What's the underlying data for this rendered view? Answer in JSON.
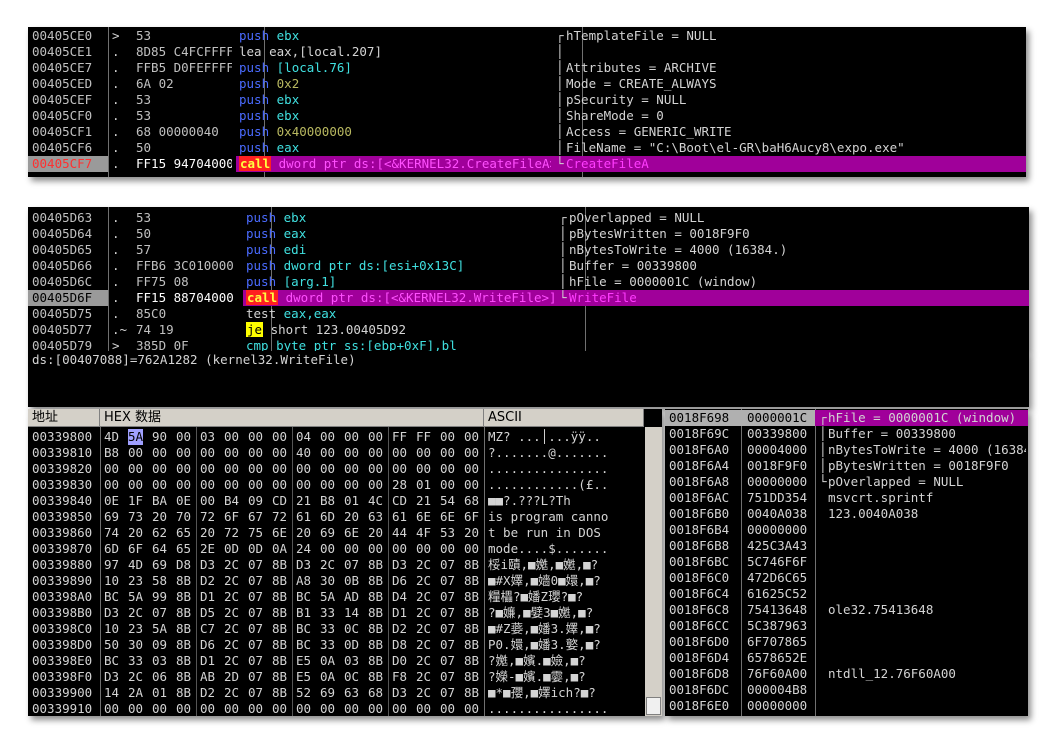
{
  "disasm_top": {
    "rows": [
      {
        "addr": "00405CE0",
        "mark": ">",
        "hex": "53",
        "instr": [
          [
            "push ",
            "blue"
          ],
          [
            "ebx",
            "cyan"
          ]
        ],
        "comment": "hTemplateFile = NULL",
        "bracket": "┌"
      },
      {
        "addr": "00405CE1",
        "mark": ".",
        "hex": "8D85 C4FCFFFF",
        "instr": [
          [
            "lea eax,[local.207]",
            "white"
          ]
        ],
        "comment": "",
        "bracket": "│"
      },
      {
        "addr": "00405CE7",
        "mark": ".",
        "hex": "FFB5 D0FEFFFF",
        "instr": [
          [
            "push ",
            "blue"
          ],
          [
            "[local.76]",
            "cyan"
          ]
        ],
        "comment": "Attributes = ARCHIVE",
        "bracket": "│"
      },
      {
        "addr": "00405CED",
        "mark": ".",
        "hex": "6A 02",
        "instr": [
          [
            "push ",
            "blue"
          ],
          [
            "0x2",
            "olive"
          ]
        ],
        "comment": "Mode = CREATE_ALWAYS",
        "bracket": "│"
      },
      {
        "addr": "00405CEF",
        "mark": ".",
        "hex": "53",
        "instr": [
          [
            "push ",
            "blue"
          ],
          [
            "ebx",
            "cyan"
          ]
        ],
        "comment": "pSecurity = NULL",
        "bracket": "│"
      },
      {
        "addr": "00405CF0",
        "mark": ".",
        "hex": "53",
        "instr": [
          [
            "push ",
            "blue"
          ],
          [
            "ebx",
            "cyan"
          ]
        ],
        "comment": "ShareMode = 0",
        "bracket": "│"
      },
      {
        "addr": "00405CF1",
        "mark": ".",
        "hex": "68 00000040",
        "instr": [
          [
            "push ",
            "blue"
          ],
          [
            "0x40000000",
            "olive"
          ]
        ],
        "comment": "Access = GENERIC_WRITE",
        "bracket": "│"
      },
      {
        "addr": "00405CF6",
        "mark": ".",
        "hex": "50",
        "instr": [
          [
            "push ",
            "blue"
          ],
          [
            "eax",
            "cyan"
          ]
        ],
        "comment": "FileName = \"C:\\Boot\\el-GR\\baH6Aucy8\\expo.exe\"",
        "bracket": "│"
      },
      {
        "addr": "00405CF7",
        "mark": ".",
        "hex": "FF15 94704000",
        "instr": [
          [
            "call",
            "callbox"
          ],
          [
            " dword ptr ds:[<&KERNEL32.CreateFileA>]",
            "mag"
          ]
        ],
        "comment": "CreateFileA",
        "bracket": "└",
        "selected": true
      }
    ]
  },
  "disasm_mid": {
    "rows": [
      {
        "addr": "00405D63",
        "mark": ".",
        "hex": "53",
        "instr": [
          [
            "push ",
            "blue"
          ],
          [
            "ebx",
            "cyan"
          ]
        ],
        "comment": "pOverlapped = NULL",
        "bracket": "┌"
      },
      {
        "addr": "00405D64",
        "mark": ".",
        "hex": "50",
        "instr": [
          [
            "push ",
            "blue"
          ],
          [
            "eax",
            "cyan"
          ]
        ],
        "comment": "pBytesWritten = 0018F9F0",
        "bracket": "│"
      },
      {
        "addr": "00405D65",
        "mark": ".",
        "hex": "57",
        "instr": [
          [
            "push ",
            "blue"
          ],
          [
            "edi",
            "cyan"
          ]
        ],
        "comment": "nBytesToWrite = 4000 (16384.)",
        "bracket": "│"
      },
      {
        "addr": "00405D66",
        "mark": ".",
        "hex": "FFB6 3C010000",
        "instr": [
          [
            "push ",
            "blue"
          ],
          [
            "dword ptr ds:[esi+0x13C]",
            "cyan"
          ]
        ],
        "comment": "Buffer = 00339800",
        "bracket": "│"
      },
      {
        "addr": "00405D6C",
        "mark": ".",
        "hex": "FF75 08",
        "instr": [
          [
            "push ",
            "blue"
          ],
          [
            "[arg.1]",
            "cyan"
          ]
        ],
        "comment": "hFile = 0000001C (window)",
        "bracket": "│"
      },
      {
        "addr": "00405D6F",
        "mark": ".",
        "hex": "FF15 88704000",
        "instr": [
          [
            "call",
            "callbox"
          ],
          [
            " dword ptr ds:[<&KERNEL32.WriteFile>]",
            "mag"
          ]
        ],
        "comment": "WriteFile",
        "bracket": "└",
        "selected": true
      },
      {
        "addr": "00405D75",
        "mark": ".",
        "hex": "85C0",
        "instr": [
          [
            "test ",
            "white"
          ],
          [
            "eax,eax",
            "cyan"
          ]
        ],
        "comment": "",
        "bracket": ""
      },
      {
        "addr": "00405D77",
        "mark": ".~",
        "hex": "74 19",
        "instr": [
          [
            "je",
            "jebox"
          ],
          [
            " short 123.00405D92",
            "white"
          ]
        ],
        "comment": "",
        "bracket": ""
      },
      {
        "addr": "00405D79",
        "mark": ">",
        "hex": "385D 0F",
        "instr": [
          [
            "cmp byte ptr ss:[ebp+0xF],bl",
            "cyan"
          ]
        ],
        "comment": "",
        "bracket": ""
      }
    ],
    "info": "ds:[00407088]=762A1282 (kernel32.WriteFile)"
  },
  "dump": {
    "headers": {
      "addr": "地址",
      "hex": "HEX 数据",
      "ascii": "ASCII"
    },
    "rows": [
      {
        "addr": "00339800",
        "hex": [
          "4D",
          "5A",
          "90",
          "00",
          "03",
          "00",
          "00",
          "00",
          "04",
          "00",
          "00",
          "00",
          "FF",
          "FF",
          "00",
          "00"
        ],
        "ascii": "MZ? ...│...ÿÿ.."
      },
      {
        "addr": "00339810",
        "hex": [
          "B8",
          "00",
          "00",
          "00",
          "00",
          "00",
          "00",
          "00",
          "40",
          "00",
          "00",
          "00",
          "00",
          "00",
          "00",
          "00"
        ],
        "ascii": "?.......@......."
      },
      {
        "addr": "00339820",
        "hex": [
          "00",
          "00",
          "00",
          "00",
          "00",
          "00",
          "00",
          "00",
          "00",
          "00",
          "00",
          "00",
          "00",
          "00",
          "00",
          "00"
        ],
        "ascii": "................"
      },
      {
        "addr": "00339830",
        "hex": [
          "00",
          "00",
          "00",
          "00",
          "00",
          "00",
          "00",
          "00",
          "00",
          "00",
          "00",
          "00",
          "28",
          "01",
          "00",
          "00"
        ],
        "ascii": "............(£.."
      },
      {
        "addr": "00339840",
        "hex": [
          "0E",
          "1F",
          "BA",
          "0E",
          "00",
          "B4",
          "09",
          "CD",
          "21",
          "B8",
          "01",
          "4C",
          "CD",
          "21",
          "54",
          "68"
        ],
        "ascii": "■■?.???L?Th"
      },
      {
        "addr": "00339850",
        "hex": [
          "69",
          "73",
          "20",
          "70",
          "72",
          "6F",
          "67",
          "72",
          "61",
          "6D",
          "20",
          "63",
          "61",
          "6E",
          "6E",
          "6F"
        ],
        "ascii": "is program canno"
      },
      {
        "addr": "00339860",
        "hex": [
          "74",
          "20",
          "62",
          "65",
          "20",
          "72",
          "75",
          "6E",
          "20",
          "69",
          "6E",
          "20",
          "44",
          "4F",
          "53",
          "20"
        ],
        "ascii": "t be run in DOS "
      },
      {
        "addr": "00339870",
        "hex": [
          "6D",
          "6F",
          "64",
          "65",
          "2E",
          "0D",
          "0D",
          "0A",
          "24",
          "00",
          "00",
          "00",
          "00",
          "00",
          "00",
          "00"
        ],
        "ascii": "mode....$......."
      },
      {
        "addr": "00339880",
        "hex": [
          "97",
          "4D",
          "69",
          "D8",
          "D3",
          "2C",
          "07",
          "8B",
          "D3",
          "2C",
          "07",
          "8B",
          "D3",
          "2C",
          "07",
          "8B"
        ],
        "ascii": "桵i賾,■嬔,■嬔,■?"
      },
      {
        "addr": "00339890",
        "hex": [
          "10",
          "23",
          "58",
          "8B",
          "D2",
          "2C",
          "07",
          "8B",
          "A8",
          "30",
          "0B",
          "8B",
          "D6",
          "2C",
          "07",
          "8B"
        ],
        "ascii": "■#X嬕,■嬙0■嬛,■?"
      },
      {
        "addr": "003398A0",
        "hex": [
          "BC",
          "5A",
          "99",
          "8B",
          "D1",
          "2C",
          "07",
          "8B",
          "BC",
          "5A",
          "AD",
          "8B",
          "D4",
          "2C",
          "07",
          "8B"
        ],
        "ascii": "糧櫑?■嬏Z瓔?■?"
      },
      {
        "addr": "003398B0",
        "hex": [
          "D3",
          "2C",
          "07",
          "8B",
          "D5",
          "2C",
          "07",
          "8B",
          "B1",
          "33",
          "14",
          "8B",
          "D1",
          "2C",
          "07",
          "8B"
        ],
        "ascii": "?■嬚,■嬖3■嬔,■?"
      },
      {
        "addr": "003398C0",
        "hex": [
          "10",
          "23",
          "5A",
          "8B",
          "C7",
          "2C",
          "07",
          "8B",
          "BC",
          "33",
          "0C",
          "8B",
          "D2",
          "2C",
          "07",
          "8B"
        ],
        "ascii": "■#Z嬊,■嬏3.嬕,■?"
      },
      {
        "addr": "003398D0",
        "hex": [
          "50",
          "30",
          "09",
          "8B",
          "D6",
          "2C",
          "07",
          "8B",
          "BC",
          "33",
          "0D",
          "8B",
          "D8",
          "2C",
          "07",
          "8B"
        ],
        "ascii": "P0.嬛,■嬏3.嬜,■?"
      },
      {
        "addr": "003398E0",
        "hex": [
          "BC",
          "33",
          "03",
          "8B",
          "D1",
          "2C",
          "07",
          "8B",
          "E5",
          "0A",
          "03",
          "8B",
          "D0",
          "2C",
          "07",
          "8B"
        ],
        "ascii": "?嬔,■嬪.■嬐,■?"
      },
      {
        "addr": "003398F0",
        "hex": [
          "D3",
          "2C",
          "06",
          "8B",
          "AB",
          "2D",
          "07",
          "8B",
          "E5",
          "0A",
          "0C",
          "8B",
          "F8",
          "2C",
          "07",
          "8B"
        ],
        "ascii": "?嬫-■嬪.■孁,■?"
      },
      {
        "addr": "00339900",
        "hex": [
          "14",
          "2A",
          "01",
          "8B",
          "D2",
          "2C",
          "07",
          "8B",
          "52",
          "69",
          "63",
          "68",
          "D3",
          "2C",
          "07",
          "8B"
        ],
        "ascii": "■*■孾,■嬕ich?■?"
      },
      {
        "addr": "00339910",
        "hex": [
          "00",
          "00",
          "00",
          "00",
          "00",
          "00",
          "00",
          "00",
          "00",
          "00",
          "00",
          "00",
          "00",
          "00",
          "00",
          "00"
        ],
        "ascii": "................"
      }
    ]
  },
  "stack": {
    "rows": [
      {
        "addr": "0018F698",
        "val": "0000001C",
        "comment": "hFile = 0000001C (window)",
        "bracket": "┌",
        "selected": true
      },
      {
        "addr": "0018F69C",
        "val": "00339800",
        "comment": "Buffer = 00339800",
        "bracket": "│"
      },
      {
        "addr": "0018F6A0",
        "val": "00004000",
        "comment": "nBytesToWrite = 4000 (16384.)",
        "bracket": "│"
      },
      {
        "addr": "0018F6A4",
        "val": "0018F9F0",
        "comment": "pBytesWritten = 0018F9F0",
        "bracket": "│"
      },
      {
        "addr": "0018F6A8",
        "val": "00000000",
        "comment": "pOverlapped = NULL",
        "bracket": "└"
      },
      {
        "addr": "0018F6AC",
        "val": "751DD354",
        "comment": "msvcrt.sprintf",
        "bracket": ""
      },
      {
        "addr": "0018F6B0",
        "val": "0040A038",
        "comment": "123.0040A038",
        "bracket": ""
      },
      {
        "addr": "0018F6B4",
        "val": "00000000",
        "comment": "",
        "bracket": ""
      },
      {
        "addr": "0018F6B8",
        "val": "425C3A43",
        "comment": "",
        "bracket": ""
      },
      {
        "addr": "0018F6BC",
        "val": "5C746F6F",
        "comment": "",
        "bracket": ""
      },
      {
        "addr": "0018F6C0",
        "val": "472D6C65",
        "comment": "",
        "bracket": ""
      },
      {
        "addr": "0018F6C4",
        "val": "61625C52",
        "comment": "",
        "bracket": ""
      },
      {
        "addr": "0018F6C8",
        "val": "75413648",
        "comment": "ole32.75413648",
        "bracket": ""
      },
      {
        "addr": "0018F6CC",
        "val": "5C387963",
        "comment": "",
        "bracket": ""
      },
      {
        "addr": "0018F6D0",
        "val": "6F707865",
        "comment": "",
        "bracket": ""
      },
      {
        "addr": "0018F6D4",
        "val": "6578652E",
        "comment": "",
        "bracket": ""
      },
      {
        "addr": "0018F6D8",
        "val": "76F60A00",
        "comment": "ntdll_12.76F60A00",
        "bracket": ""
      },
      {
        "addr": "0018F6DC",
        "val": "000004B8",
        "comment": "",
        "bracket": ""
      },
      {
        "addr": "0018F6E0",
        "val": "00000000",
        "comment": "",
        "bracket": ""
      }
    ]
  }
}
